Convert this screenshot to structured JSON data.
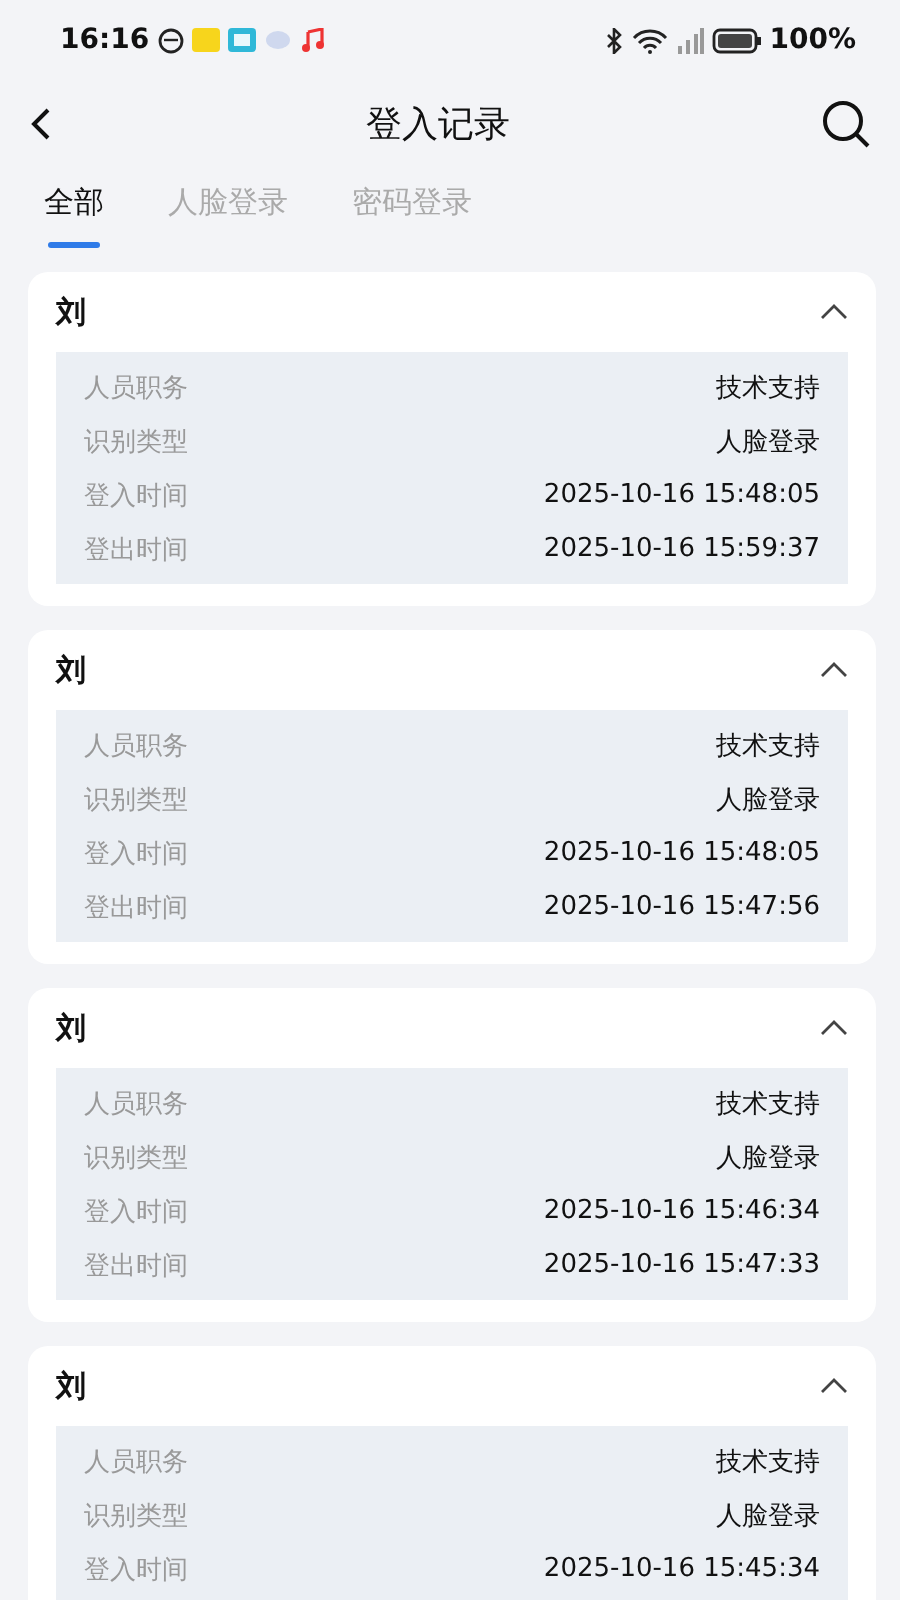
{
  "status_bar": {
    "time": "16:16",
    "battery": "100%"
  },
  "header": {
    "title": "登入记录"
  },
  "tabs": [
    {
      "label": "全部",
      "selected": true
    },
    {
      "label": "人脸登录",
      "selected": false
    },
    {
      "label": "密码登录",
      "selected": false
    }
  ],
  "records": [
    {
      "name": "刘",
      "expanded": true,
      "fields": [
        {
          "label": "人员职务",
          "value": "技术支持"
        },
        {
          "label": "识别类型",
          "value": "人脸登录"
        },
        {
          "label": "登入时间",
          "value": "2025-10-16 15:48:05"
        },
        {
          "label": "登出时间",
          "value": "2025-10-16 15:59:37"
        }
      ]
    },
    {
      "name": "刘",
      "expanded": true,
      "fields": [
        {
          "label": "人员职务",
          "value": "技术支持"
        },
        {
          "label": "识别类型",
          "value": "人脸登录"
        },
        {
          "label": "登入时间",
          "value": "2025-10-16 15:48:05"
        },
        {
          "label": "登出时间",
          "value": "2025-10-16 15:47:56"
        }
      ]
    },
    {
      "name": "刘",
      "expanded": true,
      "fields": [
        {
          "label": "人员职务",
          "value": "技术支持"
        },
        {
          "label": "识别类型",
          "value": "人脸登录"
        },
        {
          "label": "登入时间",
          "value": "2025-10-16 15:46:34"
        },
        {
          "label": "登出时间",
          "value": "2025-10-16 15:47:33"
        }
      ]
    },
    {
      "name": "刘",
      "expanded": true,
      "fields": [
        {
          "label": "人员职务",
          "value": "技术支持"
        },
        {
          "label": "识别类型",
          "value": "人脸登录"
        },
        {
          "label": "登入时间",
          "value": "2025-10-16 15:45:34"
        }
      ]
    }
  ]
}
